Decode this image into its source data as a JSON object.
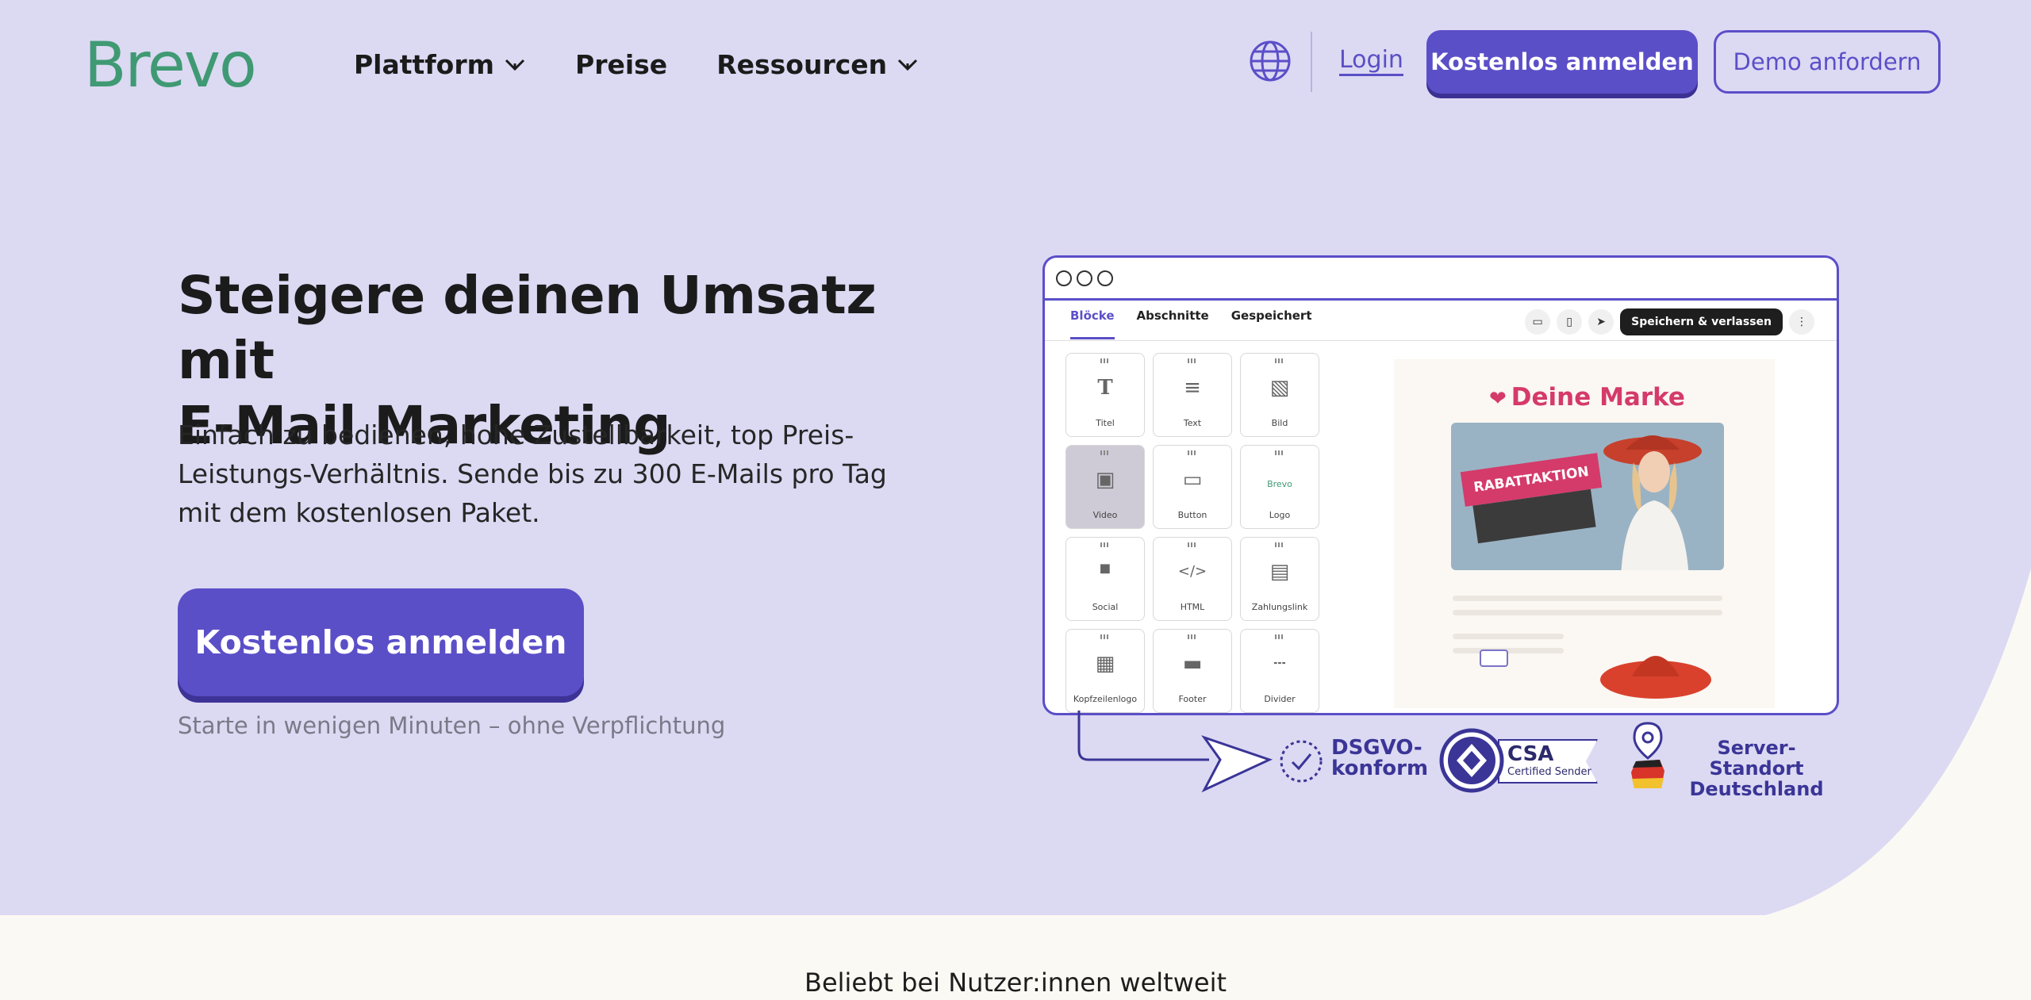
{
  "header": {
    "logo": "Brevo",
    "nav": [
      {
        "label": "Plattform",
        "has_dropdown": true
      },
      {
        "label": "Preise",
        "has_dropdown": false
      },
      {
        "label": "Ressourcen",
        "has_dropdown": true
      }
    ],
    "login": "Login",
    "signup": "Kostenlos anmelden",
    "demo": "Demo anfordern"
  },
  "hero": {
    "title_line1": "Steigere deinen Umsatz mit",
    "title_line2": "E-Mail Marketing",
    "subtitle_line1": "Einfach zu bedienen, hohe Zustellbarkeit, top Preis-",
    "subtitle_line2": "Leistungs-Verhältnis. Sende bis zu 300 E-Mails pro Tag",
    "subtitle_line3": "mit dem kostenlosen Paket.",
    "cta": "Kostenlos anmelden",
    "note": "Starte in wenigen Minuten – ohne Verpflichtung"
  },
  "editor": {
    "tabs": [
      "Blöcke",
      "Abschnitte",
      "Gespeichert"
    ],
    "save": "Speichern & verlassen",
    "blocks": [
      {
        "label": "Titel",
        "icon": "T"
      },
      {
        "label": "Text",
        "icon": "≡"
      },
      {
        "label": "Bild",
        "icon": "▧"
      },
      {
        "label": "Video",
        "icon": "▣"
      },
      {
        "label": "Button",
        "icon": "▭"
      },
      {
        "label": "Logo",
        "icon": "Brevo"
      },
      {
        "label": "Social",
        "icon": "◼"
      },
      {
        "label": "HTML",
        "icon": "</>"
      },
      {
        "label": "Zahlungslink",
        "icon": "▤"
      },
      {
        "label": "Kopfzeilenlogo",
        "icon": "▦"
      },
      {
        "label": "Footer",
        "icon": "▬"
      },
      {
        "label": "Divider",
        "icon": "┄"
      }
    ],
    "preview": {
      "brand": "Deine Marke",
      "promo": "RABATTAKTION"
    }
  },
  "badges": {
    "dsgvo_line1": "DSGVO-",
    "dsgvo_line2": "konform",
    "csa_title": "CSA",
    "csa_sub": "Certified Sender",
    "server_line1": "Server-Standort",
    "server_line2": "Deutschland"
  },
  "band": {
    "title": "Beliebt bei Nutzer:innen weltweit"
  },
  "colors": {
    "background": "#dcd9f3",
    "primary": "#5b4fc8",
    "logo": "#3f9a73",
    "brand_pink": "#d43a6a"
  }
}
